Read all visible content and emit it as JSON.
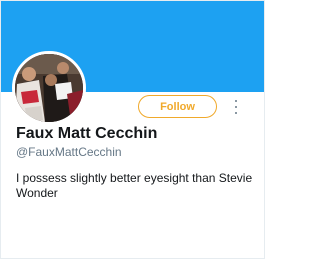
{
  "profile": {
    "name": "Faux Matt Cecchin",
    "handle": "@FauxMattCecchin",
    "bio": "I possess slightly better eyesight than Stevie Wonder"
  },
  "actions": {
    "follow_label": "Follow"
  },
  "icons": {
    "more": "more-vertical-icon"
  },
  "colors": {
    "banner": "#1da1f2",
    "accent": "#f0a92b",
    "name": "#14171a",
    "secondary": "#657786"
  }
}
